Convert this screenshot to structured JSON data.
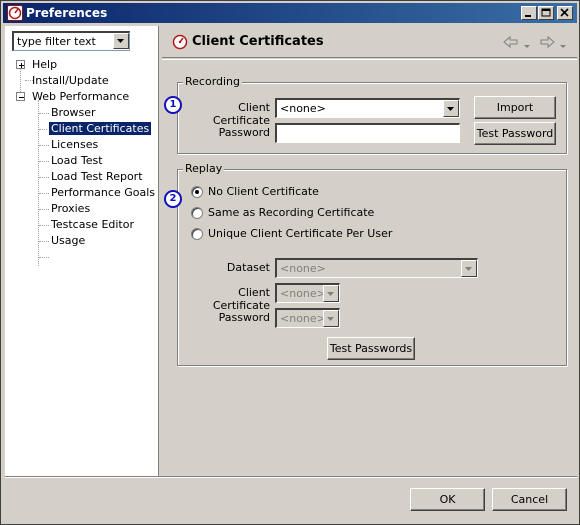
{
  "window": {
    "title": "Preferences"
  },
  "filter": {
    "value": "type filter text"
  },
  "tree": {
    "items": [
      {
        "label": "Help",
        "expander": "+"
      },
      {
        "label": "Install/Update"
      },
      {
        "label": "Web Performance",
        "expander": "-"
      },
      {
        "label": "Browser"
      },
      {
        "label": "Client Certificates",
        "selected": true
      },
      {
        "label": "Licenses"
      },
      {
        "label": "Load Test"
      },
      {
        "label": "Load Test Report"
      },
      {
        "label": "Performance Goals"
      },
      {
        "label": "Proxies"
      },
      {
        "label": "Testcase Editor"
      },
      {
        "label": "Usage"
      }
    ]
  },
  "page": {
    "title": "Client Certificates",
    "icons": {
      "page": "certificate-icon",
      "back": "back-arrow-icon",
      "forward": "forward-arrow-icon"
    }
  },
  "recording": {
    "legend": "Recording",
    "badge": "1",
    "cert_label": "Client Certificate",
    "cert_value": "<none>",
    "password_label": "Password",
    "password_value": "",
    "import_label": "Import",
    "test_password_label": "Test Password"
  },
  "replay": {
    "legend": "Replay",
    "badge": "2",
    "options": [
      {
        "label": "No Client Certificate",
        "checked": true
      },
      {
        "label": "Same as Recording Certificate",
        "checked": false
      },
      {
        "label": "Unique Client Certificate Per User",
        "checked": false
      }
    ],
    "dataset_label": "Dataset",
    "dataset_value": "<none>",
    "cert_label": "Client Certificate",
    "cert_value": "<none>",
    "password_label": "Password",
    "password_value": "<none>",
    "test_passwords_label": "Test Passwords"
  },
  "footer": {
    "ok_label": "OK",
    "cancel_label": "Cancel"
  },
  "colors": {
    "titlebar": "#0a246a",
    "selection": "#0a246a",
    "badge": "#1010c0",
    "face": "#d4d0c8"
  }
}
